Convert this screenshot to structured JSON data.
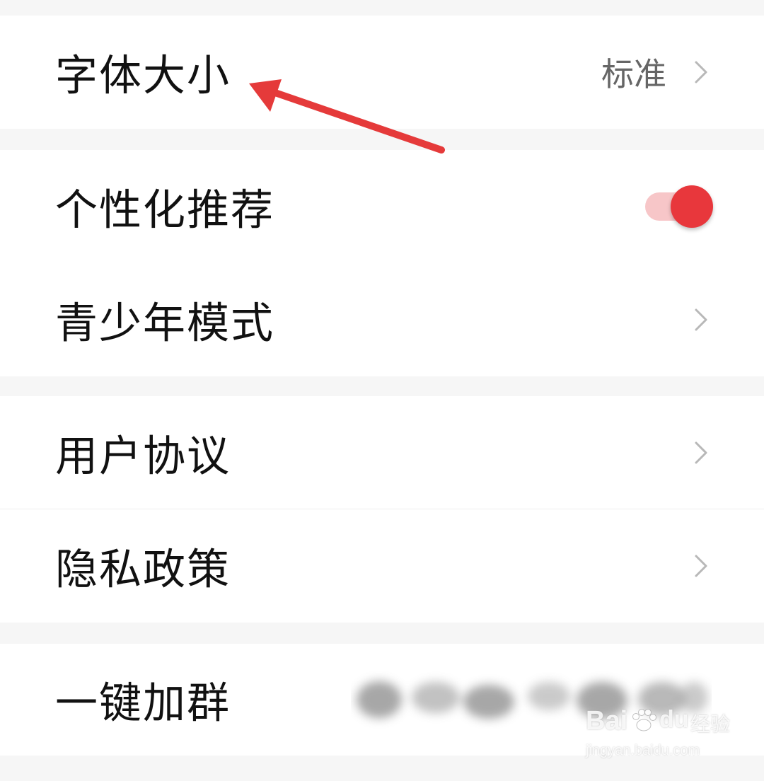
{
  "settings": {
    "font_size": {
      "label": "字体大小",
      "value": "标准"
    },
    "personalized_recommendation": {
      "label": "个性化推荐",
      "enabled": true
    },
    "teen_mode": {
      "label": "青少年模式"
    },
    "user_agreement": {
      "label": "用户协议"
    },
    "privacy_policy": {
      "label": "隐私政策"
    },
    "join_group": {
      "label": "一键加群"
    }
  },
  "colors": {
    "accent": "#e8373c",
    "toggle_track": "#f7c6c8",
    "arrow": "#e53a3a",
    "background": "#f6f6f6"
  },
  "icons": {
    "chevron": "chevron-right-icon",
    "annotation": "red-arrow-icon"
  },
  "watermark": {
    "brand_left": "Bai",
    "brand_right": "du",
    "brand_suffix": "经验",
    "url": "jingyan.baidu.com"
  }
}
